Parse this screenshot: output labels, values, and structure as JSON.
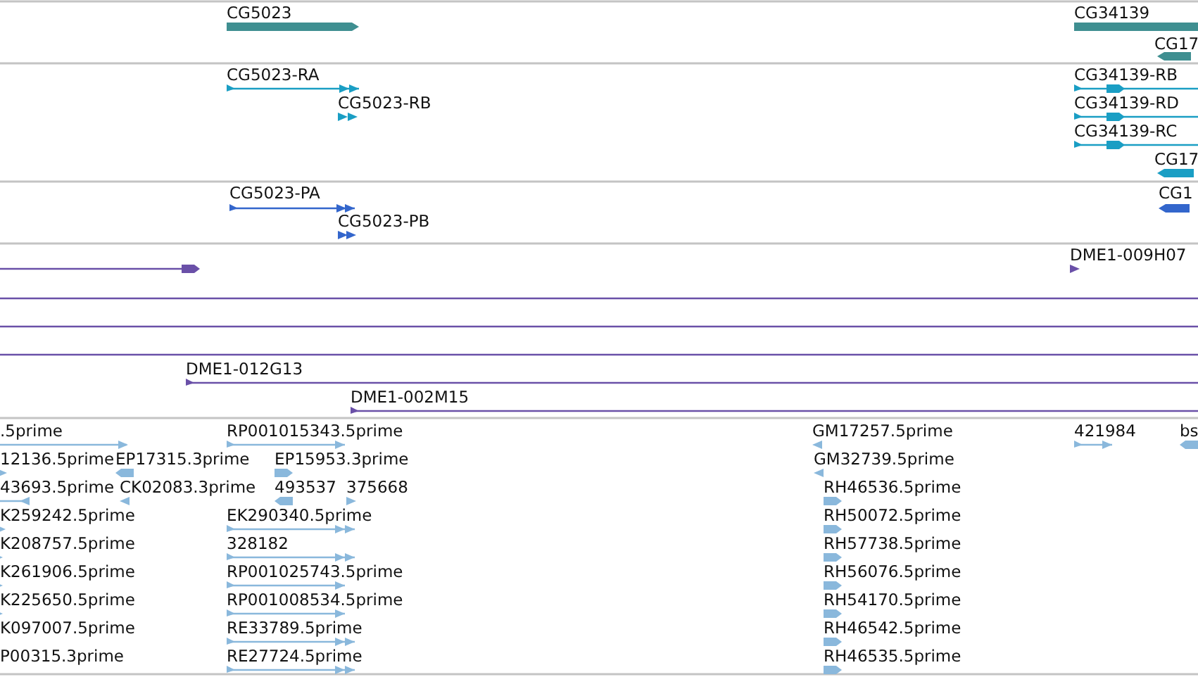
{
  "tracks": [
    {
      "color": "#3f8f91",
      "features": [
        {
          "label": "CG5023",
          "reverse": false
        },
        {
          "label": "CG34139"
        },
        {
          "label": "CG17",
          "reverse": true
        }
      ]
    },
    {
      "color": "#1a9ec4",
      "features": [
        {
          "label": "CG5023-RA",
          "reverse": false
        },
        {
          "label": "CG5023-RB",
          "reverse": false
        },
        {
          "label": "CG34139-RB",
          "reverse": false
        },
        {
          "label": "CG34139-RD",
          "reverse": false
        },
        {
          "label": "CG34139-RC",
          "reverse": false
        },
        {
          "label": "CG17",
          "reverse": true
        }
      ]
    },
    {
      "color": "#3366cc",
      "features": [
        {
          "label": "CG5023-PA",
          "reverse": false
        },
        {
          "label": "CG5023-PB",
          "reverse": false
        },
        {
          "label": "CG1",
          "reverse": true
        }
      ]
    },
    {
      "color": "#6a50a8",
      "features": [
        {
          "reverse": false
        },
        {
          "label": "DME1-009H07",
          "reverse": false
        },
        {
          "label": "DME1-012G13",
          "reverse": false
        },
        {
          "label": "DME1-002M15",
          "reverse": false
        }
      ]
    },
    {
      "color": "#8ab8dc",
      "features": [
        {
          "label": ".5prime",
          "reverse": false
        },
        {
          "label": "RP001015343.5prime",
          "reverse": false
        },
        {
          "label": "GM17257.5prime",
          "reverse": true
        },
        {
          "label": "421984",
          "reverse": false
        },
        {
          "label": "bs",
          "reverse": true
        },
        {
          "label": "12136.5prime",
          "reverse": false
        },
        {
          "label": "EP17315.3prime",
          "reverse": true
        },
        {
          "label": "EP15953.3prime",
          "reverse": false
        },
        {
          "label": "GM32739.5prime",
          "reverse": true
        },
        {
          "label": "43693.5prime",
          "reverse": true
        },
        {
          "label": "CK02083.3prime",
          "reverse": true
        },
        {
          "label": "493537",
          "reverse": true
        },
        {
          "label": "375668",
          "reverse": false
        },
        {
          "label": "RH46536.5prime",
          "reverse": false
        },
        {
          "label": "K259242.5prime",
          "reverse": false
        },
        {
          "label": "EK290340.5prime",
          "reverse": false
        },
        {
          "label": "RH50072.5prime",
          "reverse": false
        },
        {
          "label": "K208757.5prime",
          "reverse": false
        },
        {
          "label": "328182",
          "reverse": false
        },
        {
          "label": "RH57738.5prime",
          "reverse": false
        },
        {
          "label": "K261906.5prime",
          "reverse": false
        },
        {
          "label": "RP001025743.5prime",
          "reverse": false
        },
        {
          "label": "RH56076.5prime",
          "reverse": false
        },
        {
          "label": "K225650.5prime",
          "reverse": false
        },
        {
          "label": "RP001008534.5prime",
          "reverse": false
        },
        {
          "label": "RH54170.5prime",
          "reverse": false
        },
        {
          "label": "K097007.5prime"
        },
        {
          "label": "RE33789.5prime",
          "reverse": false
        },
        {
          "label": "RH46542.5prime",
          "reverse": false
        },
        {
          "label": "P00315.3prime"
        },
        {
          "label": "RE27724.5prime",
          "reverse": false
        },
        {
          "label": "RH46535.5prime",
          "reverse": false
        }
      ]
    }
  ]
}
